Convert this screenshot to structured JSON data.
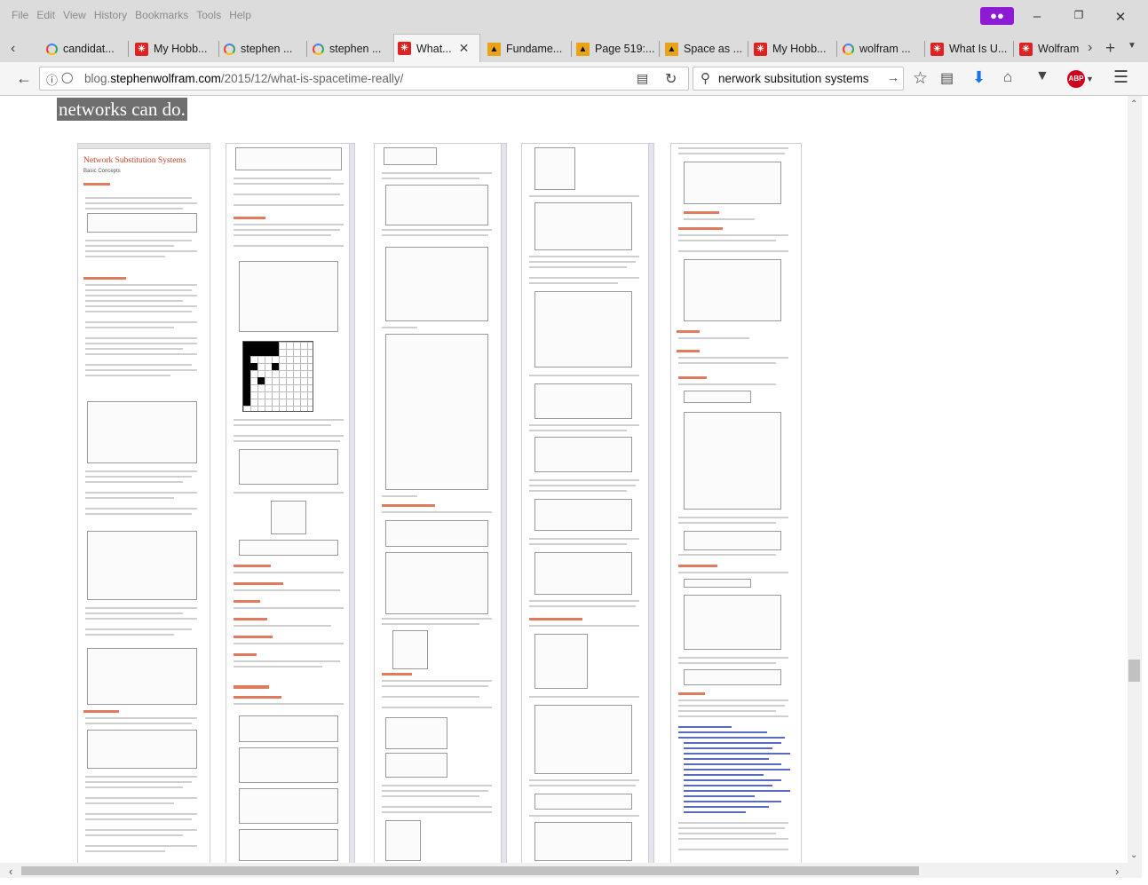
{
  "menu": [
    "File",
    "Edit",
    "View",
    "History",
    "Bookmarks",
    "Tools",
    "Help"
  ],
  "tabs": [
    {
      "label": "candidat...",
      "icon": "google-icon"
    },
    {
      "label": "My Hobb...",
      "icon": "wolfram-icon"
    },
    {
      "label": "stephen ...",
      "icon": "google-icon"
    },
    {
      "label": "stephen ...",
      "icon": "google-icon"
    },
    {
      "label": "What...",
      "icon": "wolfram-icon",
      "active": true
    },
    {
      "label": "Fundame...",
      "icon": "book-icon"
    },
    {
      "label": "Page 519:...",
      "icon": "book-icon"
    },
    {
      "label": "Space as ...",
      "icon": "book-icon"
    },
    {
      "label": "My Hobb...",
      "icon": "wolfram-icon"
    },
    {
      "label": "wolfram ...",
      "icon": "google-icon"
    },
    {
      "label": "What Is U...",
      "icon": "wolfram-icon"
    },
    {
      "label": "Wolfram",
      "icon": "wolfram-icon"
    }
  ],
  "url": {
    "prefix": "blog.",
    "domain": "stephenwolfram.com",
    "path": "/2015/12/what-is-spacetime-really/"
  },
  "search": {
    "value": "nerwork subsitution systems"
  },
  "content": {
    "heading_fragment": "networks can do.",
    "page1_title": "Network Substitution Systems",
    "page1_subtitle": "Basic Concepts"
  },
  "colors": {
    "accent_title": "#c2432b",
    "private_mask": "#8e1ad3",
    "abp": "#d0021b"
  }
}
